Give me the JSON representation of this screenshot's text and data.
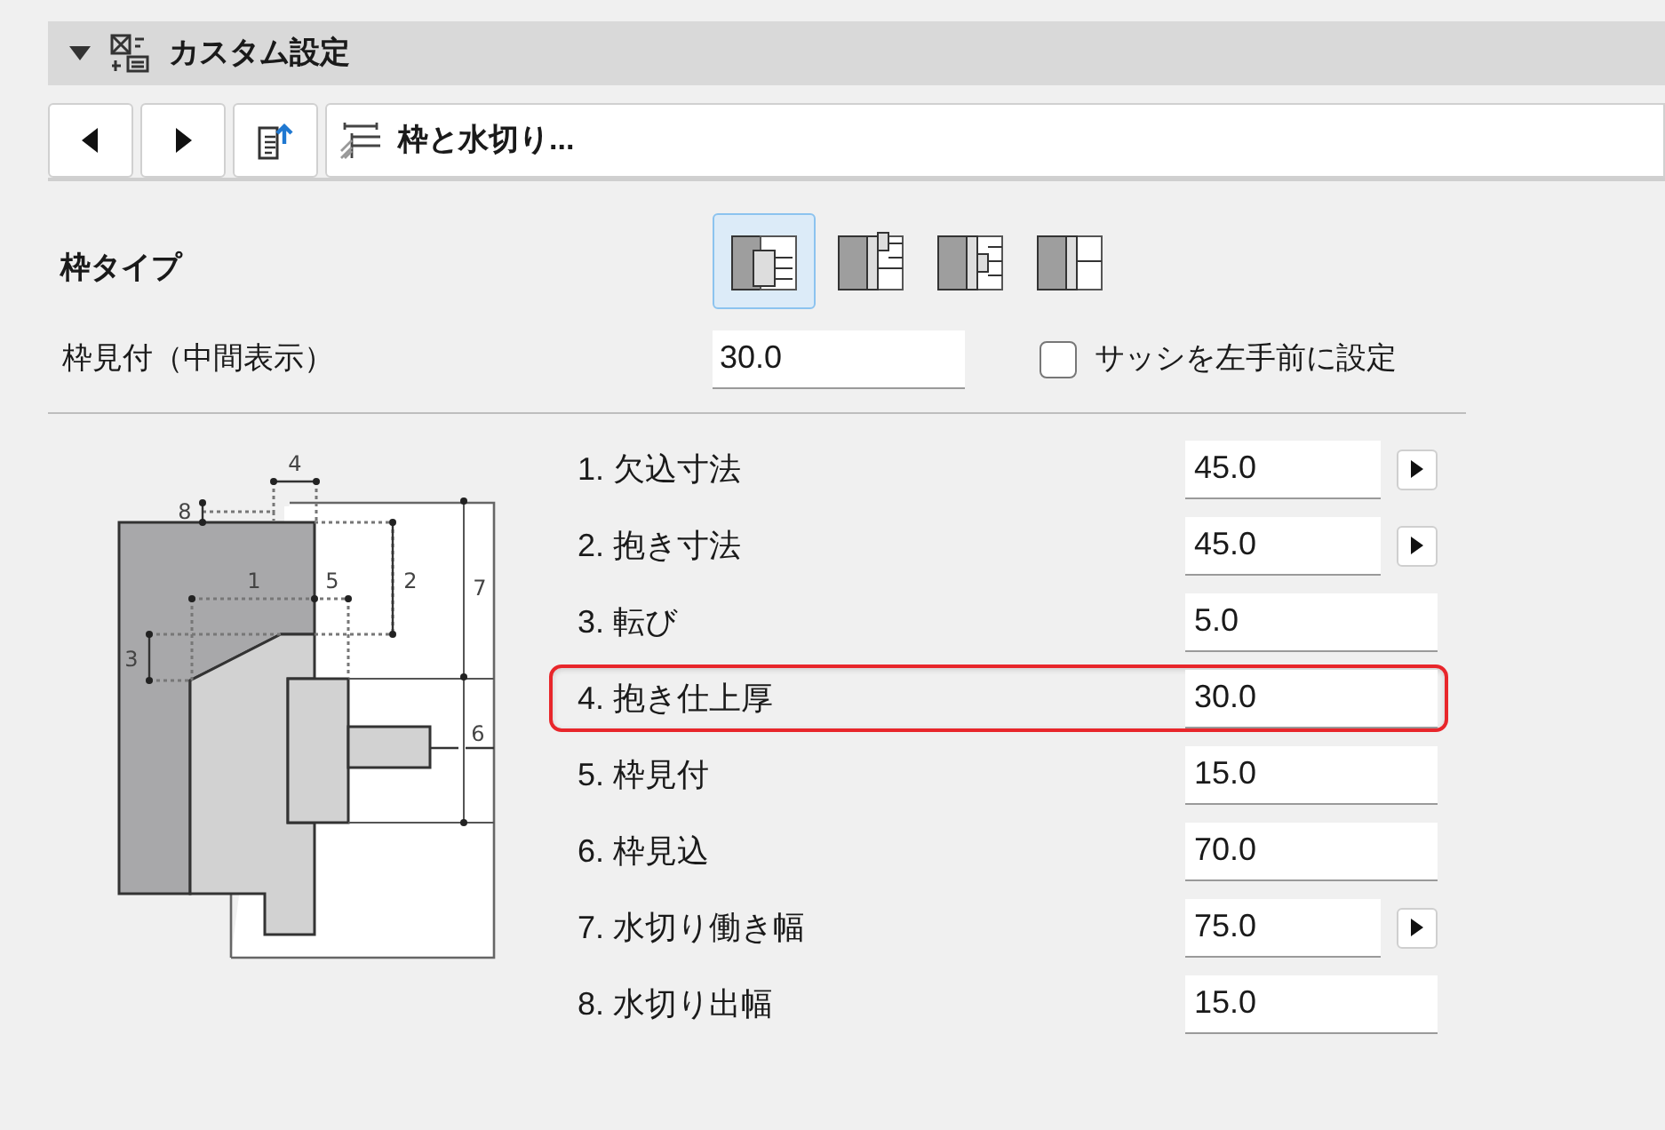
{
  "panel": {
    "title": "カスタム設定",
    "expanded": true
  },
  "toolbar": {
    "path": "枠と水切り..."
  },
  "frame_type": {
    "label": "枠タイプ",
    "options": [
      {
        "selected": true
      },
      {
        "selected": false
      },
      {
        "selected": false
      },
      {
        "selected": false
      }
    ]
  },
  "frame_face": {
    "label": "枠見付（中間表示）",
    "value": "30.0"
  },
  "sash_left": {
    "label": "サッシを左手前に設定",
    "checked": false
  },
  "diagram_labels": [
    "4",
    "8",
    "1",
    "5",
    "2",
    "7",
    "3",
    "6"
  ],
  "params": [
    {
      "label": "1. 欠込寸法",
      "value": "45.0",
      "has_arrow": true,
      "highlighted": false
    },
    {
      "label": "2. 抱き寸法",
      "value": "45.0",
      "has_arrow": true,
      "highlighted": false
    },
    {
      "label": "3. 転び",
      "value": "5.0",
      "has_arrow": false,
      "highlighted": false
    },
    {
      "label": "4. 抱き仕上厚",
      "value": "30.0",
      "has_arrow": false,
      "highlighted": true
    },
    {
      "label": "5. 枠見付",
      "value": "15.0",
      "has_arrow": false,
      "highlighted": false
    },
    {
      "label": "6. 枠見込",
      "value": "70.0",
      "has_arrow": false,
      "highlighted": false
    },
    {
      "label": "7. 水切り働き幅",
      "value": "75.0",
      "has_arrow": true,
      "highlighted": false
    },
    {
      "label": "8. 水切り出幅",
      "value": "15.0",
      "has_arrow": false,
      "highlighted": false
    }
  ]
}
